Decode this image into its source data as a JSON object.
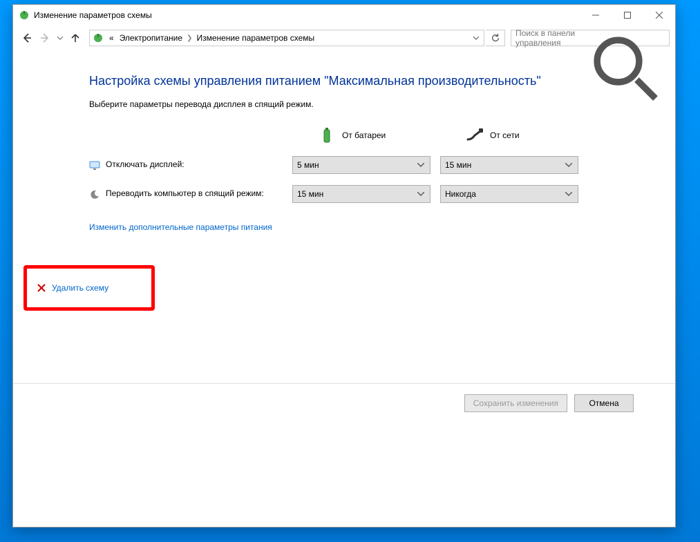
{
  "window": {
    "title": "Изменение параметров схемы"
  },
  "breadcrumb": {
    "prefix": "«",
    "item1": "Электропитание",
    "item2": "Изменение параметров схемы"
  },
  "search": {
    "placeholder": "Поиск в панели управления"
  },
  "page": {
    "heading": "Настройка схемы управления питанием \"Максимальная производительность\"",
    "subtext": "Выберите параметры перевода дисплея в спящий режим."
  },
  "columns": {
    "battery": "От батареи",
    "plugged": "От сети"
  },
  "rows": {
    "display_off": "Отключать дисплей:",
    "sleep": "Переводить компьютер в спящий режим:"
  },
  "values": {
    "display_off_battery": "5 мин",
    "display_off_plugged": "15 мин",
    "sleep_battery": "15 мин",
    "sleep_plugged": "Никогда"
  },
  "links": {
    "advanced": "Изменить дополнительные параметры питания",
    "delete": "Удалить схему"
  },
  "buttons": {
    "save": "Сохранить изменения",
    "cancel": "Отмена"
  }
}
